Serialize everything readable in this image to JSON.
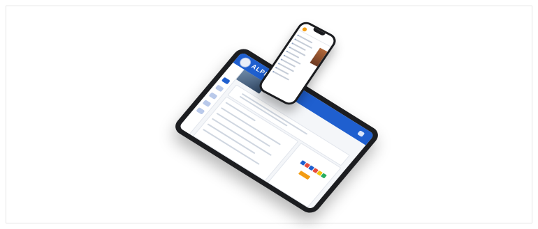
{
  "tablet": {
    "logo_text": "ALPHA",
    "accent_color": "#1f5fcf",
    "highlight_color": "#f39c12"
  },
  "phone": {
    "accent_color": "#f39c12"
  }
}
